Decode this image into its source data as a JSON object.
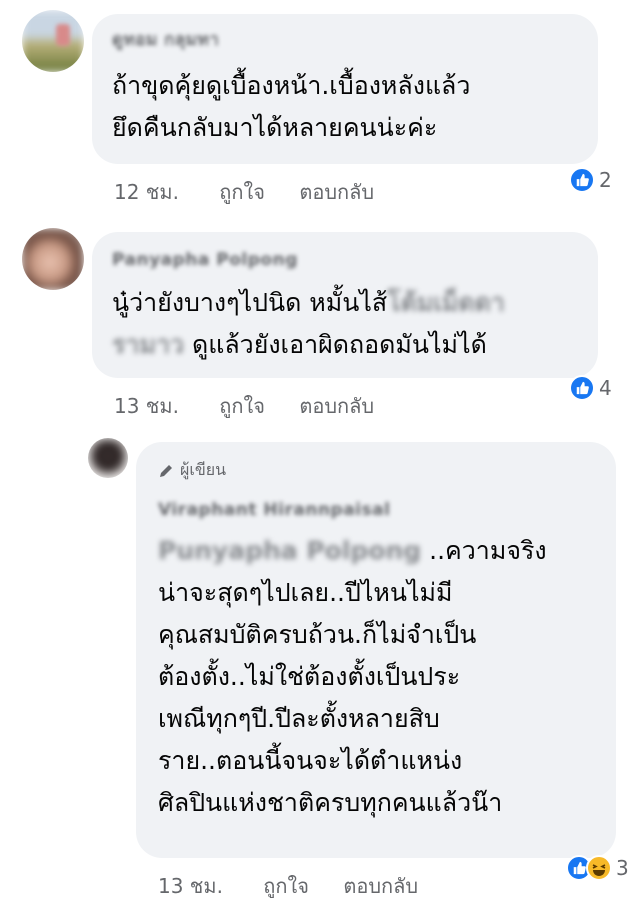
{
  "comments": [
    {
      "author_name": "ดูทอม กลุมทา",
      "lines": [
        "ถ้าขุดคุ้ยดูเบื้องหน้า.เบื้องหลังแล้ว",
        "ยึดคืนกลับมาได้หลายคนน่ะค่ะ"
      ],
      "time": "12 ชม.",
      "like_label": "ถูกใจ",
      "reply_label": "ตอบกลับ",
      "reaction_count": "2"
    },
    {
      "author_name": "Panyapha Polpong",
      "line1": "นู๋ว่ายังบางๆไปนิด หมั้นไส้",
      "tag_part1": "โต้มเม็ดดา",
      "tag_part2": "รามาว",
      "line2_rest": "ดูแล้วยังเอาผิดถอดมันไม่ได้",
      "time": "13 ชม.",
      "like_label": "ถูกใจ",
      "reply_label": "ตอบกลับ",
      "reaction_count": "4"
    },
    {
      "author_badge": "ผู้เขียน",
      "author_name": "Viraphant Hirannpaisal",
      "mention": "Punyapha Polpong",
      "first_line_rest": "..ความจริง",
      "lines": [
        "น่าจะสุดๆไปเลย..ปีไหนไม่มี",
        "คุณสมบัติครบถ้วน.ก็ไม่จำเป็น",
        "ต้องตั้ง..ไม่ใช่ต้องตั้งเป็นประ",
        "เพณีทุกๆปี.ปีละตั้งหลายสิบ",
        "ราย..ตอนนี้จนจะได้ตำแหน่ง",
        "ศิลปินแห่งชาติครบทุกคนแล้วน๊า"
      ],
      "time": "13 ชม.",
      "like_label": "ถูกใจ",
      "reply_label": "ตอบกลับ",
      "reaction_count": "3"
    }
  ],
  "colors": {
    "bubble": "#f0f2f5",
    "like_blue": "#1877f2",
    "haha_yellow": "#f7b928",
    "meta_gray": "#65676b"
  }
}
